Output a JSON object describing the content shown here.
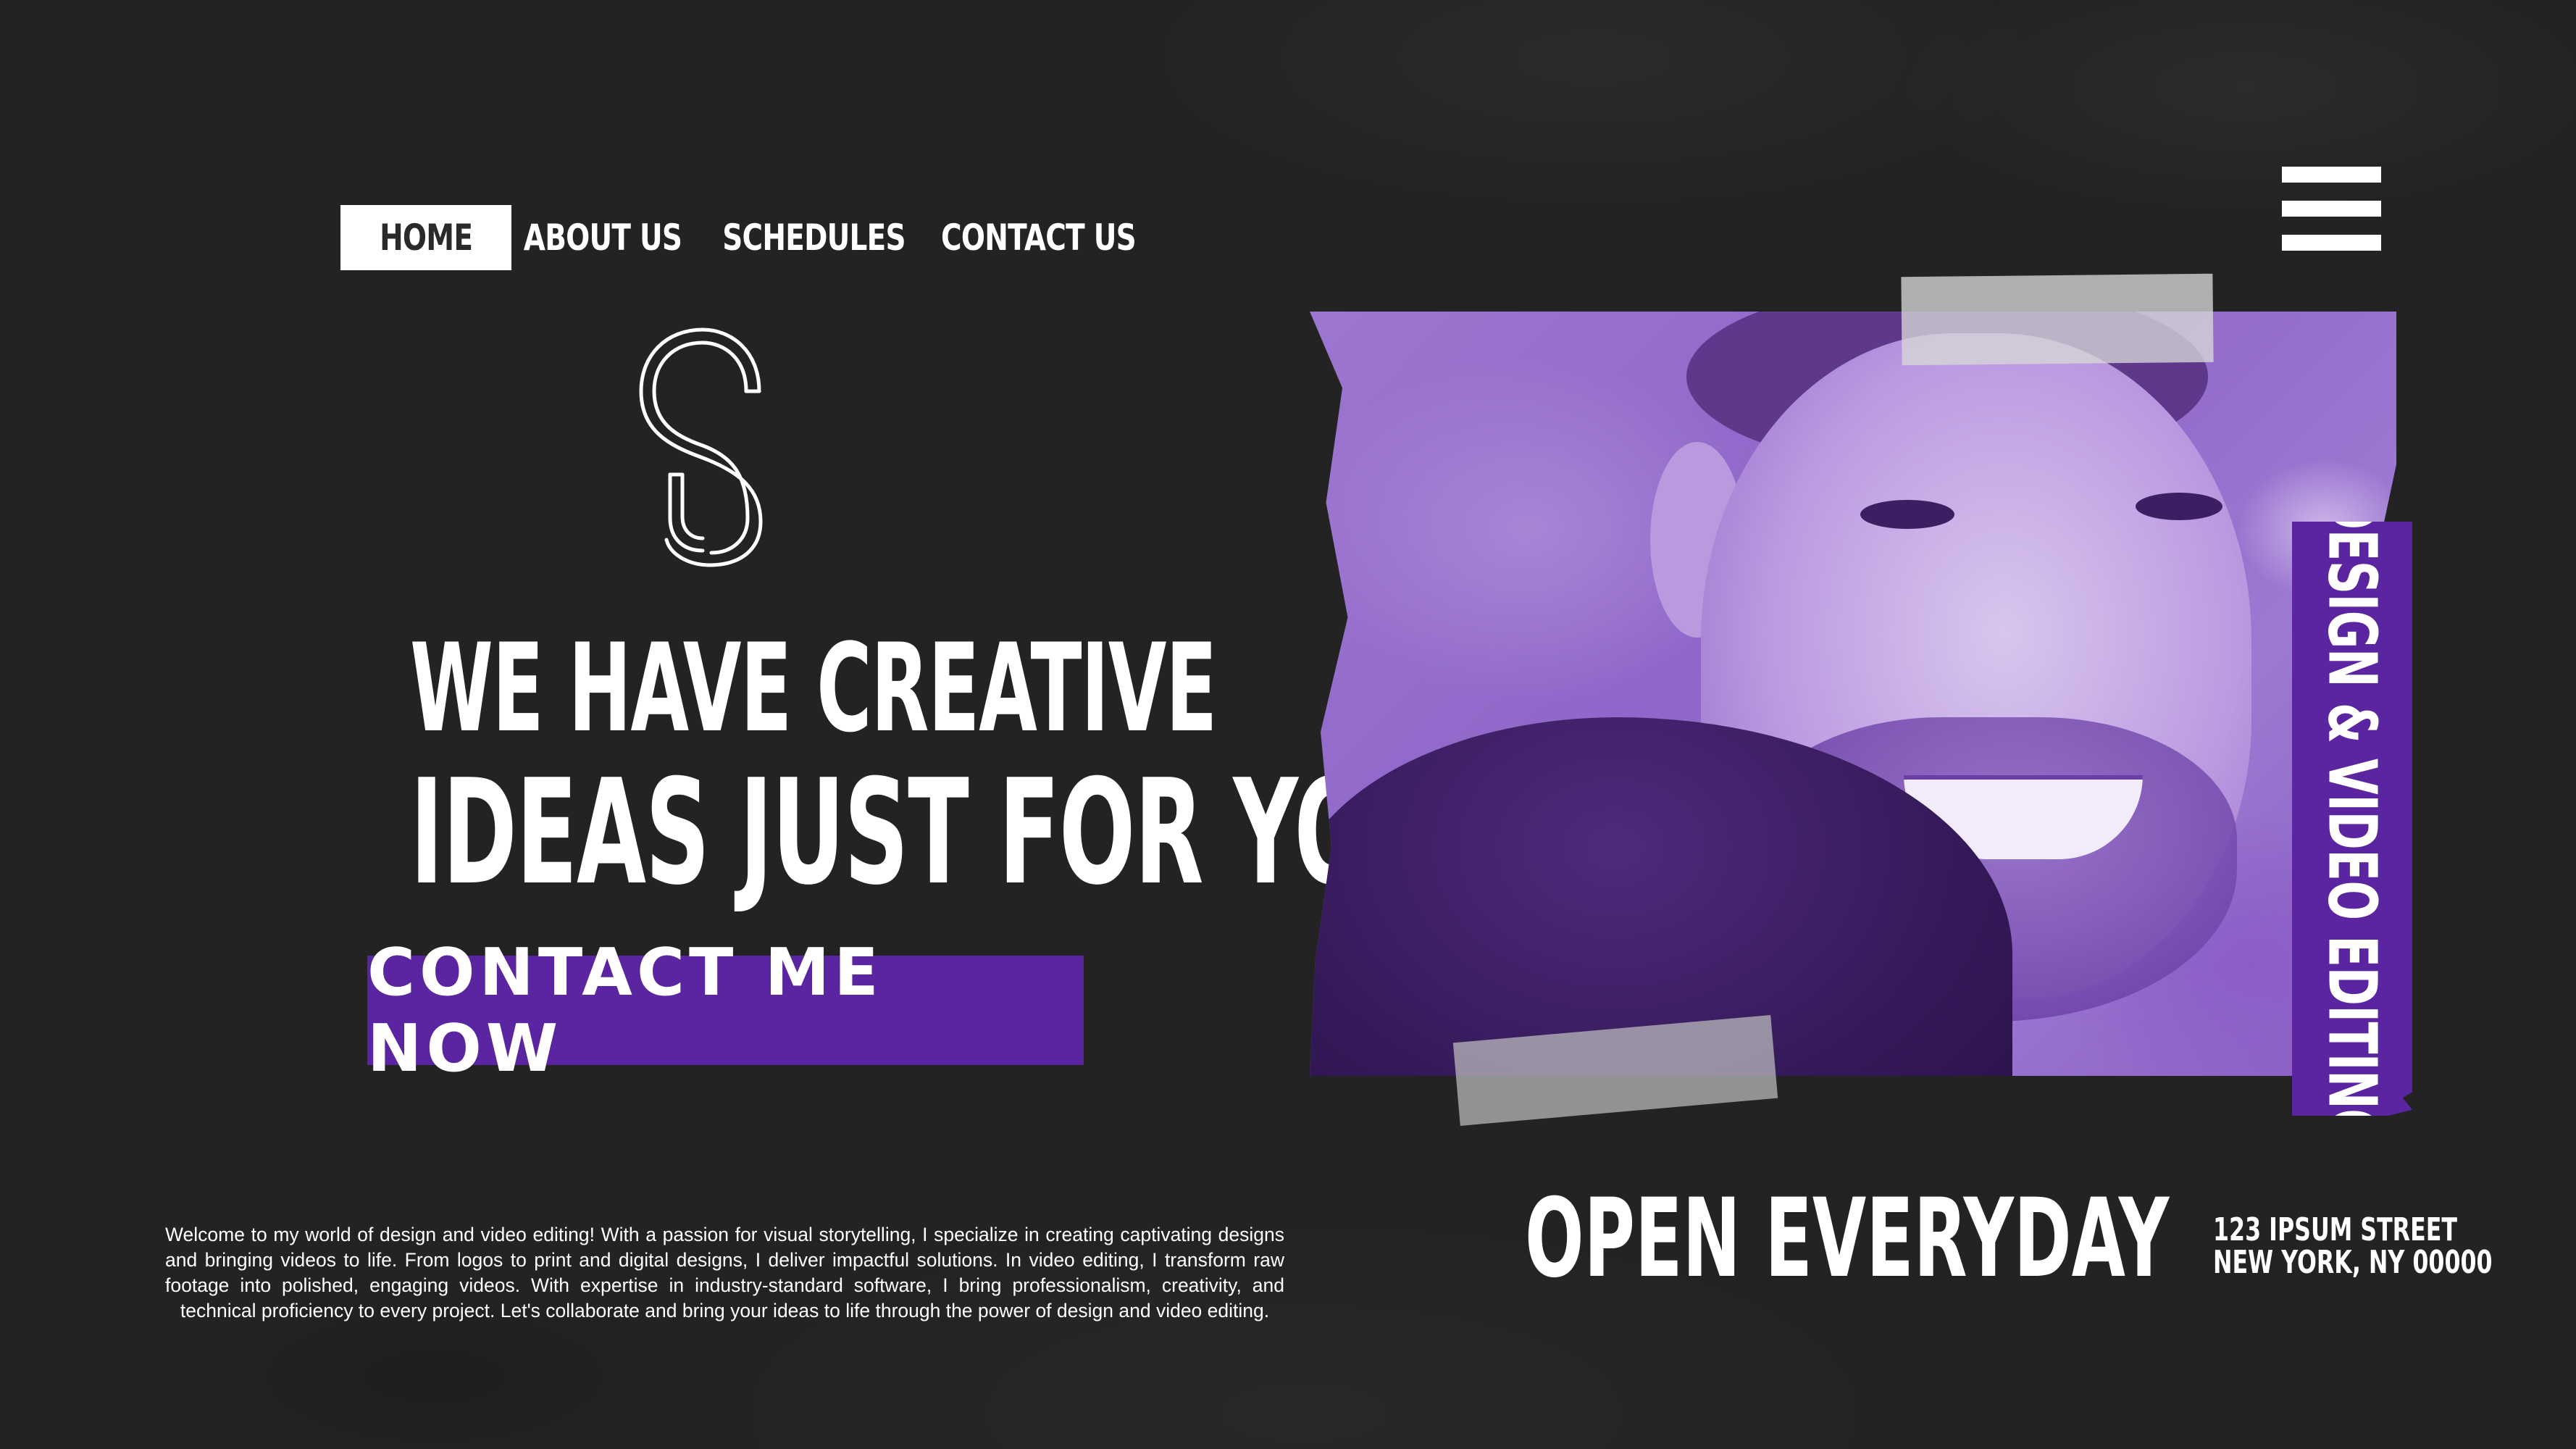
{
  "nav": {
    "items": [
      {
        "label": "HOME",
        "active": true
      },
      {
        "label": "ABOUT US",
        "active": false
      },
      {
        "label": "SCHEDULES",
        "active": false
      },
      {
        "label": "CONTACT US",
        "active": false
      }
    ]
  },
  "hero": {
    "headline_line1": "WE HAVE CREATIVE",
    "headline_line2": "IDEAS JUST FOR YOU",
    "cta_label": "CONTACT ME NOW"
  },
  "intro_text": "Welcome to my world of design and video editing! With a passion for visual storytelling, I specialize in creating captivating designs and bringing videos to life. From logos to print and digital designs, I deliver impactful solutions. In video editing, I transform raw footage into polished, engaging videos. With expertise in industry-standard software, I bring professionalism, creativity, and technical proficiency to every project. Let's collaborate and bring your ideas to life through the power of design and video editing.",
  "side_banner": "DESIGN & VIDEO EDITING",
  "hours": "OPEN EVERYDAY",
  "address": {
    "line1": "123 IPSUM STREET",
    "line2": "NEW YORK, NY 00000"
  },
  "icons": {
    "logo": "cs-monogram-logo",
    "menu": "hamburger-menu-icon"
  },
  "colors": {
    "background": "#232323",
    "accent": "#5b24a0",
    "text": "#ffffff"
  }
}
